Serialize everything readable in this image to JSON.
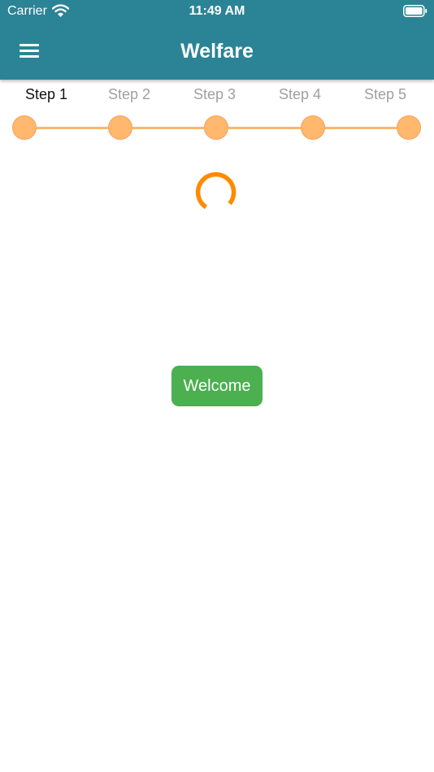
{
  "status_bar": {
    "carrier": "Carrier",
    "time": "11:49 AM",
    "icons": [
      "wifi-icon",
      "battery-icon"
    ]
  },
  "header": {
    "title": "Welfare",
    "menu_icon": "hamburger-menu-icon",
    "background_color": "#2a8496"
  },
  "stepper": {
    "steps": [
      {
        "label": "Step 1",
        "active": true
      },
      {
        "label": "Step 2",
        "active": false
      },
      {
        "label": "Step 3",
        "active": false
      },
      {
        "label": "Step 4",
        "active": false
      },
      {
        "label": "Step 5",
        "active": false
      }
    ],
    "active_step": 1,
    "accent_color": "#ffb86d"
  },
  "loading_indicator": {
    "icon": "loading-spinner-icon",
    "color": "#ff8a00"
  },
  "main": {
    "welcome_button_label": "Welcome",
    "button_color": "#4caf50"
  }
}
